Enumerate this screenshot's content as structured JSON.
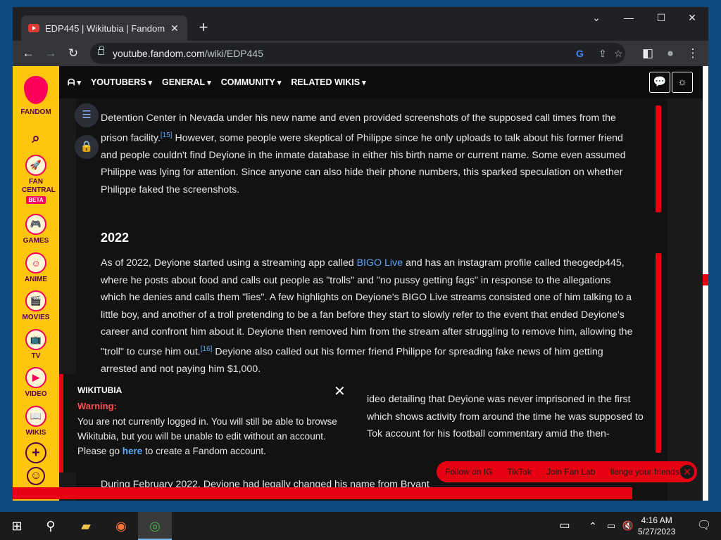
{
  "browser": {
    "tab_title": "EDP445 | Wikitubia | Fandom",
    "url_host": "youtube.fandom.com",
    "url_path": "/wiki/EDP445",
    "new_tab": "+",
    "tab_close": "✕",
    "back": "←",
    "forward": "→",
    "reload": "↻",
    "min": "—",
    "max": "☐",
    "close": "✕",
    "chevron": "⌄",
    "g_icon": "G",
    "share": "⇪",
    "star": "☆",
    "side": "◧",
    "profile": "●",
    "menu": "⋮"
  },
  "rail": {
    "logo": "FANDOM",
    "items": [
      {
        "label": "FAN CENTRAL",
        "badge": "BETA",
        "icon": "🚀"
      },
      {
        "label": "GAMES",
        "icon": "🎮"
      },
      {
        "label": "ANIME",
        "icon": "☺"
      },
      {
        "label": "MOVIES",
        "icon": "🎬"
      },
      {
        "label": "TV",
        "icon": "📺"
      },
      {
        "label": "VIDEO",
        "icon": "▶"
      },
      {
        "label": "WIKIS",
        "icon": "📖"
      }
    ],
    "search": "⌕",
    "add": "+",
    "user": "☺"
  },
  "nav": {
    "home": "ᗩ",
    "items": [
      "YOUTUBERS",
      "GENERAL",
      "COMMUNITY",
      "RELATED WIKIS"
    ],
    "discuss": "💬",
    "theme": "☼"
  },
  "article": {
    "p1a": "Detention Center in Nevada under his new name and even provided screenshots of the supposed call times from the",
    "p1b": "prison facility.",
    "ref15": "[15]",
    "p1c": " However, some people were skeptical of Philippe since he only uploads to talk about his former friend",
    "p1d": "and people couldn't find Deyione in the inmate database in either his birth name or current name. Some even assumed",
    "p1e": "Philippe was lying for attention. Since anyone can also hide their phone numbers, this sparked speculation on whether",
    "p1f": "Philippe faked the screenshots.",
    "h2022": "2022",
    "p2a1": "As of 2022, Deyione started using a streaming app called ",
    "p2link": "BIGO Live",
    "p2a2": " and has an instagram profile called theogedp445,",
    "p2b": "where he posts about food and calls out people as \"trolls\" and \"no pussy getting fags\" in response to the allegations",
    "p2c": "which he denies and calls them \"lies\". A few highlights on Deyione's BIGO Live streams consisted one of him talking to a",
    "p2d": "little boy, and another of a troll pretending to be a fan before they start to slowly refer to the event that ended Deyione's",
    "p2e": "career and confront him about it. Deyione then removed him from the stream after struggling to remove him, allowing the",
    "p2f1": "\"troll\" to curse him out.",
    "ref16": "[16]",
    "p2f2": " Deyione also called out his former friend Philippe for spreading fake news of him getting",
    "p2g": "arrested and not paying him $1,000.",
    "p3a": "ideo detailing that Deyione was never imprisoned in the first",
    "p3b": "which shows activity from around the time he was supposed to",
    "p3c": "Tok account for his football commentary amid the then-",
    "p4": "During February 2022, Deyione had legally changed his name from Bryant"
  },
  "warning": {
    "brand": "WIKITUBIA",
    "title": "Warning:",
    "body1": "You are not currently logged in. You will still be able to browse Wikitubia, but you will be unable to edit without an account. Please go ",
    "link": "here",
    "body2": " to create a Fandom account.",
    "close": "✕"
  },
  "promo": {
    "items": [
      "Follow on IG",
      "TikTok",
      "Join Fan Lab",
      "llenge your friends!"
    ],
    "close": "✕"
  },
  "taskbar": {
    "time": "4:16 AM",
    "date": "5/27/2023",
    "start": "⊞",
    "search": "⚲",
    "folder": "▰",
    "firefox": "◉",
    "chrome": "◎",
    "notif": "▭",
    "tray1": "⌃",
    "tray2": "▭",
    "vol": "🔇"
  },
  "colors": {
    "fandom_yellow": "#fec60f",
    "fandom_pink": "#fa005a",
    "accent_red": "#e60012",
    "link": "#5ba8ff"
  }
}
